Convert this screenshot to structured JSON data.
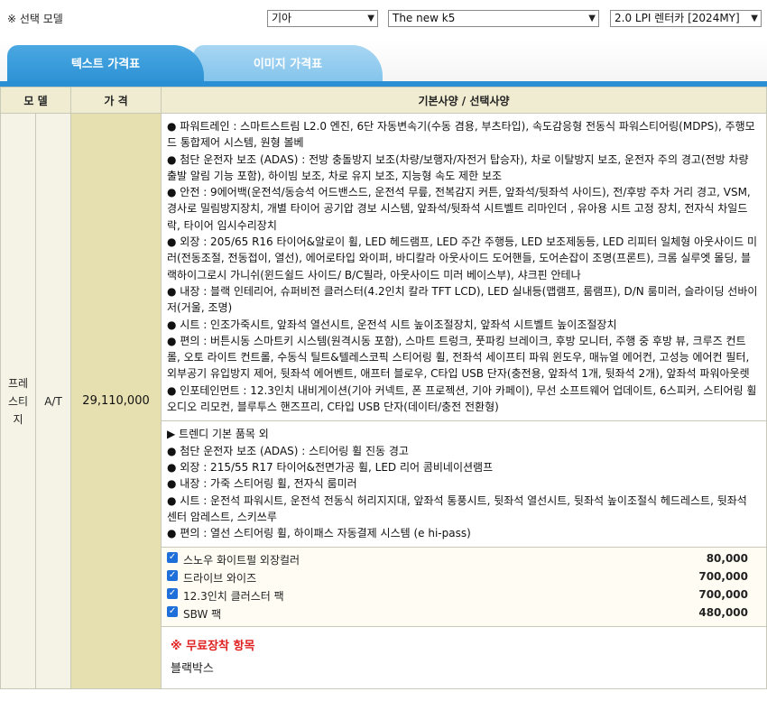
{
  "selector": {
    "label": "※ 선택 모델",
    "brand": "기아",
    "model": "The new k5",
    "trim": "2.0 LPI 렌터카 [2024MY]"
  },
  "tabs": [
    {
      "label": "텍스트 가격표"
    },
    {
      "label": "이미지 가격표"
    }
  ],
  "table": {
    "headers": {
      "model": "모 델",
      "price": "가 격",
      "features": "기본사양 / 선택사양"
    },
    "row": {
      "model": "프레스티지",
      "transmission": "A/T",
      "price": "29,110,000",
      "basic": [
        "● 파워트레인 : 스마트스트림 L2.0 엔진, 6단 자동변속기(수동 겸용, 부츠타입), 속도감응형 전동식 파워스티어링(MDPS), 주행모드 통합제어 시스템, 원형 볼베",
        "● 첨단 운전자 보조 (ADAS) : 전방 충돌방지 보조(차량/보행자/자전거 탑승자), 차로 이탈방지 보조, 운전자 주의 경고(전방 차량 출발 알림 기능 포함), 하이빔 보조, 차로 유지 보조, 지능형 속도 제한 보조",
        "● 안전 : 9에어백(운전석/동승석 어드밴스드, 운전석 무릎, 전복감지 커튼, 앞좌석/뒷좌석 사이드), 전/후방 주차 거리 경고, VSM, 경사로 밀림방지장치, 개별 타이어 공기압 경보 시스템, 앞좌석/뒷좌석 시트벨트 리마인더 , 유아용 시트 고정 장치, 전자식 차일드락, 타이어 임시수리장치",
        "● 외장 : 205/65 R16 타이어&알로이 휠, LED 헤드램프, LED 주간 주행등, LED 보조제동등, LED 리피터 일체형 아웃사이드 미러(전동조절, 전동접이, 열선), 에어로타입 와이퍼, 바디칼라 아웃사이드 도어핸들, 도어손잡이 조명(프론트), 크롬 실루엣 몰딩, 블랙하이그로시 가니쉬(윈드쉴드 사이드/ B/C필라, 아웃사이드 미러 베이스부), 샤크핀 안테나",
        "● 내장 : 블랙 인테리어, 슈퍼비전 클러스터(4.2인치 칼라 TFT LCD), LED 실내등(맵램프, 룸램프), D/N 룸미러, 슬라이딩 선바이저(거울, 조명)",
        "● 시트 : 인조가죽시트, 앞좌석 열선시트, 운전석 시트 높이조절장치, 앞좌석 시트벨트 높이조절장치",
        "● 편의 : 버튼시동 스마트키 시스템(원격시동 포함), 스마트 트렁크, 풋파킹 브레이크, 후방 모니터, 주행 중 후방 뷰, 크루즈 컨트롤, 오토 라이트 컨트롤, 수동식 틸트&텔레스코픽 스티어링 휠, 전좌석 세이프티 파워 윈도우, 매뉴얼 에어컨, 고성능 에어컨 필터, 외부공기 유입방지 제어, 뒷좌석 에어벤트, 애프터 블로우, C타입 USB 단자(충전용, 앞좌석 1개, 뒷좌석 2개), 앞좌석 파워아웃렛",
        "● 인포테인먼트 : 12.3인치 내비게이션(기아 커넥트, 폰 프로젝션, 기아 카페이), 무선 소프트웨어 업데이트, 6스피커, 스티어링 휠 오디오 리모컨, 블루투스 핸즈프리, C타입 USB 단자(데이터/충전 전환형)"
      ],
      "extra": [
        "▶ 트렌디 기본 품목 외",
        "● 첨단 운전자 보조 (ADAS) : 스티어링 휠 진동 경고",
        "● 외장 : 215/55 R17 타이어&전면가공 휠, LED 리어 콤비네이션램프",
        "● 내장 : 가죽 스티어링 휠, 전자식 룸미러",
        "● 시트 : 운전석 파워시트, 운전석 전동식 허리지지대, 앞좌석 통풍시트, 뒷좌석 열선시트, 뒷좌석 높이조절식 헤드레스트, 뒷좌석 센터 암레스트, 스키쓰루",
        "● 편의 : 열선 스티어링 휠, 하이패스 자동결제 시스템 (e hi-pass)"
      ],
      "options": [
        {
          "name": "스노우 화이트펄 외장컬러",
          "price": "80,000"
        },
        {
          "name": "드라이브 와이즈",
          "price": "700,000"
        },
        {
          "name": "12.3인치 클러스터 팩",
          "price": "700,000"
        },
        {
          "name": "SBW 팩",
          "price": "480,000"
        }
      ],
      "free_title": "※ 무료장착 항목",
      "free_items": [
        "블랙박스"
      ]
    }
  },
  "colors": {
    "tab_active": "#2a8fd3",
    "tab_inactive": "#7fc2ec",
    "header_bg": "#f0ecd2",
    "price_bg": "#e6dfb0",
    "free_title": "#e02020",
    "checkbox": "#1e6fd9"
  }
}
